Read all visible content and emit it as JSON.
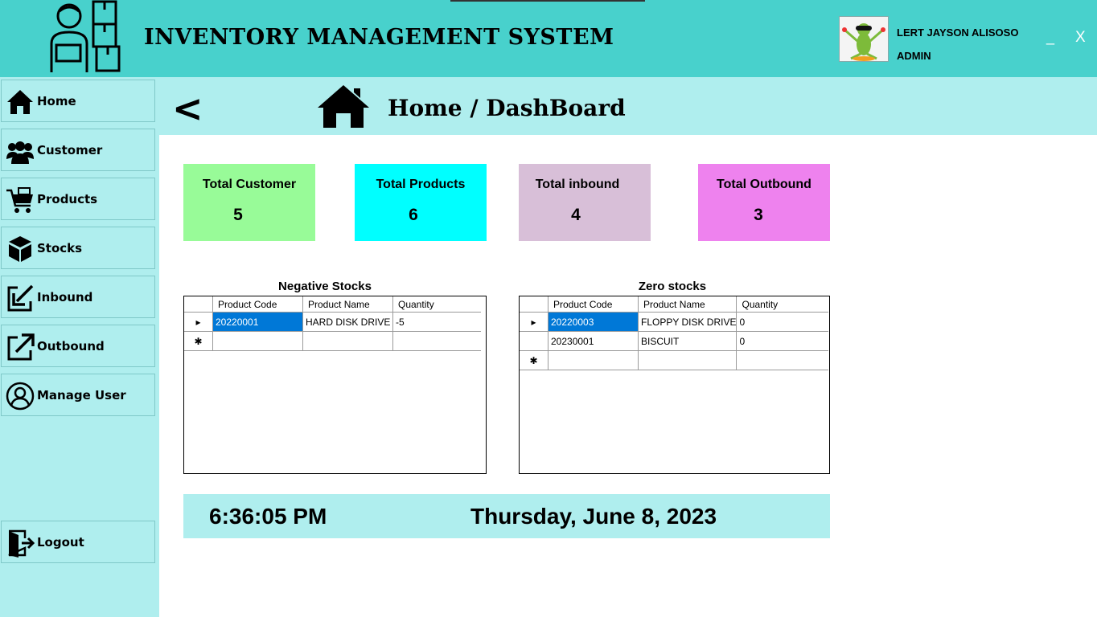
{
  "app": {
    "title": "INVENTORY MANAGEMENT SYSTEM",
    "user_name": "LERT JAYSON ALISOSO",
    "user_role": "ADMIN",
    "minimize_label": "_",
    "close_label": "X"
  },
  "sidebar": {
    "items": [
      {
        "label": "Home",
        "icon": "home-icon"
      },
      {
        "label": "Customer",
        "icon": "users-icon"
      },
      {
        "label": "Products",
        "icon": "cart-icon"
      },
      {
        "label": "Stocks",
        "icon": "boxes-icon"
      },
      {
        "label": "Inbound",
        "icon": "inbound-arrow-icon"
      },
      {
        "label": "Outbound",
        "icon": "outbound-arrow-icon"
      },
      {
        "label": "Manage User",
        "icon": "user-circle-icon"
      }
    ],
    "logout_label": "Logout"
  },
  "page": {
    "back_label": "<",
    "title": "Home / DashBoard"
  },
  "cards": [
    {
      "title": "Total Customer",
      "value": "5",
      "color": "#98FB98"
    },
    {
      "title": "Total Products",
      "value": "6",
      "color": "#00FFFF"
    },
    {
      "title": "Total inbound",
      "value": "4",
      "color": "#D8BFD8"
    },
    {
      "title": "Total Outbound",
      "value": "3",
      "color": "#EE82EE"
    }
  ],
  "negative_stocks": {
    "title": "Negative Stocks",
    "columns": [
      "Product Code",
      "Product Name",
      "Quantity"
    ],
    "rows": [
      {
        "code": "20220001",
        "name": "HARD DISK DRIVE",
        "qty": "-5"
      }
    ]
  },
  "zero_stocks": {
    "title": "Zero stocks",
    "columns": [
      "Product Code",
      "Product Name",
      "Quantity"
    ],
    "rows": [
      {
        "code": "20220003",
        "name": "FLOPPY DISK DRIVE",
        "qty": "0"
      },
      {
        "code": "20230001",
        "name": "BISCUIT",
        "qty": "0"
      }
    ]
  },
  "clock": {
    "time": "6:36:05 PM",
    "date": "Thursday, June 8, 2023"
  },
  "colors": {
    "header_bg": "#48D1CC",
    "sidebar_bg": "#AFEEEE",
    "selection": "#0078D7"
  }
}
